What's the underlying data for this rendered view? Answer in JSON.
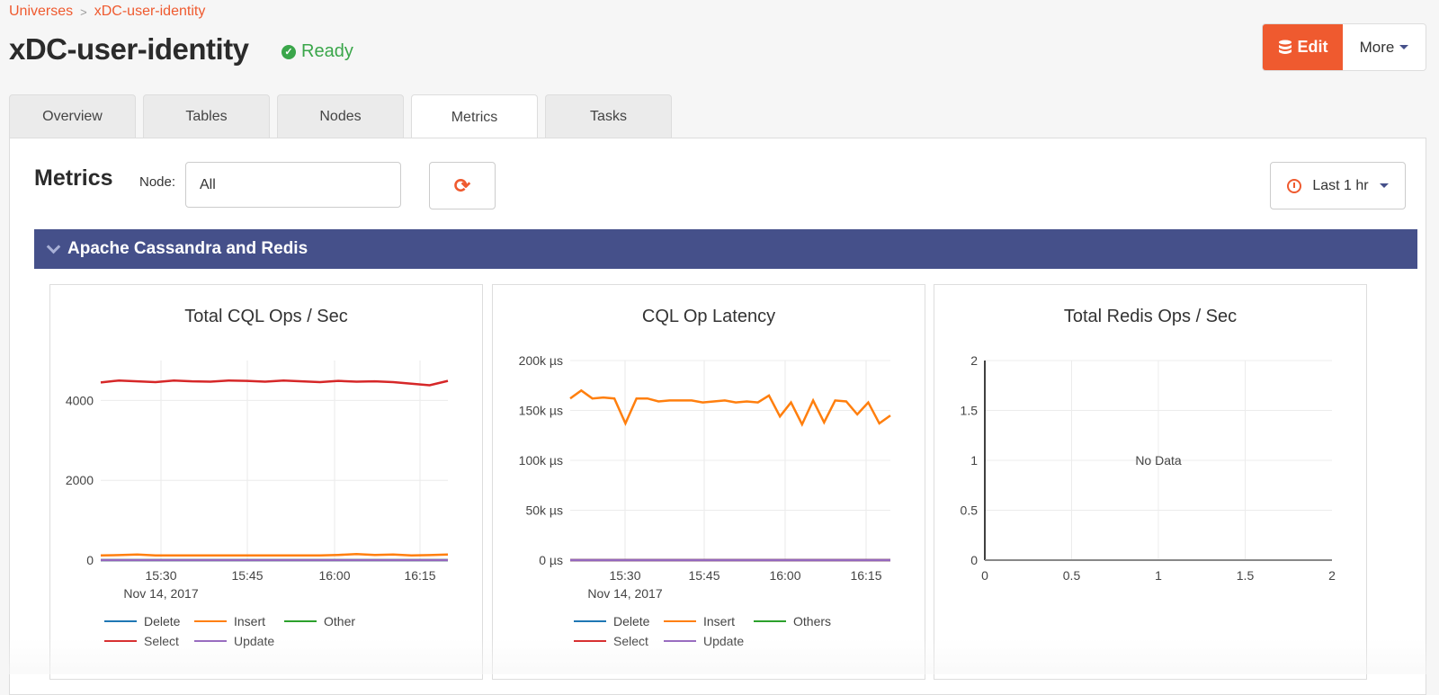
{
  "breadcrumb": {
    "items": [
      "Universes",
      "xDC-user-identity"
    ]
  },
  "header": {
    "title": "xDC-user-identity",
    "status": "Ready",
    "edit_label": "Edit",
    "more_label": "More"
  },
  "tabs": [
    {
      "label": "Overview",
      "active": false
    },
    {
      "label": "Tables",
      "active": false
    },
    {
      "label": "Nodes",
      "active": false
    },
    {
      "label": "Metrics",
      "active": true
    },
    {
      "label": "Tasks",
      "active": false
    }
  ],
  "metrics": {
    "title": "Metrics",
    "node_label": "Node:",
    "node_value": "All",
    "time_range": "Last 1 hr",
    "section_title": "Apache Cassandra and Redis"
  },
  "colors": {
    "accent": "#ef5a2f",
    "section": "#45508a",
    "ready": "#3aa64a"
  },
  "chart_data": [
    {
      "type": "line",
      "title": "Total CQL Ops / Sec",
      "x_ticks": [
        "15:30",
        "15:45",
        "16:00",
        "16:15"
      ],
      "x_sublabel": "Nov 14, 2017",
      "x_range_minutes": [
        15.3,
        16.35
      ],
      "y_ticks": [
        "0",
        "2000",
        "4000"
      ],
      "ylim": [
        0,
        5000
      ],
      "legend": [
        "Delete",
        "Insert",
        "Other",
        "Select",
        "Update"
      ],
      "series": [
        {
          "name": "Delete",
          "color": "#1f77b4",
          "values": [
            0,
            0,
            0,
            0,
            0,
            0,
            0,
            0,
            0,
            0,
            0,
            0,
            0,
            0,
            0,
            0,
            0,
            0,
            0,
            0
          ]
        },
        {
          "name": "Insert",
          "color": "#ff7f0e",
          "values": [
            120,
            125,
            140,
            120,
            120,
            120,
            120,
            120,
            120,
            120,
            120,
            120,
            120,
            130,
            150,
            130,
            140,
            120,
            125,
            140
          ]
        },
        {
          "name": "Other",
          "color": "#2ca02c",
          "values": [
            0,
            0,
            0,
            0,
            0,
            0,
            0,
            0,
            0,
            0,
            0,
            0,
            0,
            0,
            0,
            0,
            0,
            0,
            0,
            0
          ]
        },
        {
          "name": "Select",
          "color": "#d62728",
          "values": [
            4450,
            4500,
            4480,
            4460,
            4500,
            4480,
            4470,
            4500,
            4490,
            4470,
            4500,
            4480,
            4460,
            4490,
            4470,
            4480,
            4460,
            4420,
            4380,
            4490
          ]
        },
        {
          "name": "Update",
          "color": "#9467bd",
          "values": [
            0,
            0,
            0,
            0,
            0,
            0,
            0,
            0,
            0,
            0,
            0,
            0,
            0,
            0,
            0,
            0,
            0,
            0,
            0,
            0
          ]
        }
      ]
    },
    {
      "type": "line",
      "title": "CQL Op Latency",
      "x_ticks": [
        "15:30",
        "15:45",
        "16:00",
        "16:15"
      ],
      "x_sublabel": "Nov 14, 2017",
      "y_ticks": [
        "0 µs",
        "50k µs",
        "100k µs",
        "150k µs",
        "200k µs"
      ],
      "ylim": [
        0,
        200000
      ],
      "legend": [
        "Delete",
        "Insert",
        "Others",
        "Select",
        "Update"
      ],
      "series": [
        {
          "name": "Delete",
          "color": "#1f77b4",
          "values": [
            0,
            0,
            0,
            0,
            0,
            0,
            0,
            0,
            0,
            0,
            0,
            0,
            0,
            0,
            0,
            0,
            0,
            0,
            0,
            0,
            0,
            0,
            0,
            0,
            0,
            0,
            0,
            0,
            0,
            0
          ]
        },
        {
          "name": "Insert",
          "color": "#ff7f0e",
          "values": [
            162000,
            170000,
            162000,
            163000,
            162000,
            137000,
            162000,
            162000,
            159000,
            160000,
            160000,
            160000,
            158000,
            159000,
            160000,
            158000,
            159000,
            158000,
            165000,
            144000,
            158000,
            136000,
            160000,
            138000,
            160000,
            159000,
            146000,
            158000,
            137000,
            145000
          ]
        },
        {
          "name": "Others",
          "color": "#2ca02c",
          "values": [
            0,
            0,
            0,
            0,
            0,
            0,
            0,
            0,
            0,
            0,
            0,
            0,
            0,
            0,
            0,
            0,
            0,
            0,
            0,
            0,
            0,
            0,
            0,
            0,
            0,
            0,
            0,
            0,
            0,
            0
          ]
        },
        {
          "name": "Select",
          "color": "#d62728",
          "values": [
            0,
            0,
            0,
            0,
            0,
            0,
            0,
            0,
            0,
            0,
            0,
            0,
            0,
            0,
            0,
            0,
            0,
            0,
            0,
            0,
            0,
            0,
            0,
            0,
            0,
            0,
            0,
            0,
            0,
            0
          ]
        },
        {
          "name": "Update",
          "color": "#9467bd",
          "values": [
            0,
            0,
            0,
            0,
            0,
            0,
            0,
            0,
            0,
            0,
            0,
            0,
            0,
            0,
            0,
            0,
            0,
            0,
            0,
            0,
            0,
            0,
            0,
            0,
            0,
            0,
            0,
            0,
            0,
            0
          ]
        }
      ]
    },
    {
      "type": "line",
      "title": "Total Redis Ops / Sec",
      "x_ticks": [
        "0",
        "0.5",
        "1",
        "1.5",
        "2"
      ],
      "y_ticks": [
        "0",
        "0.5",
        "1",
        "1.5",
        "2"
      ],
      "xlim": [
        0,
        2
      ],
      "ylim": [
        0,
        2
      ],
      "annotation": "No Data",
      "series": []
    }
  ]
}
